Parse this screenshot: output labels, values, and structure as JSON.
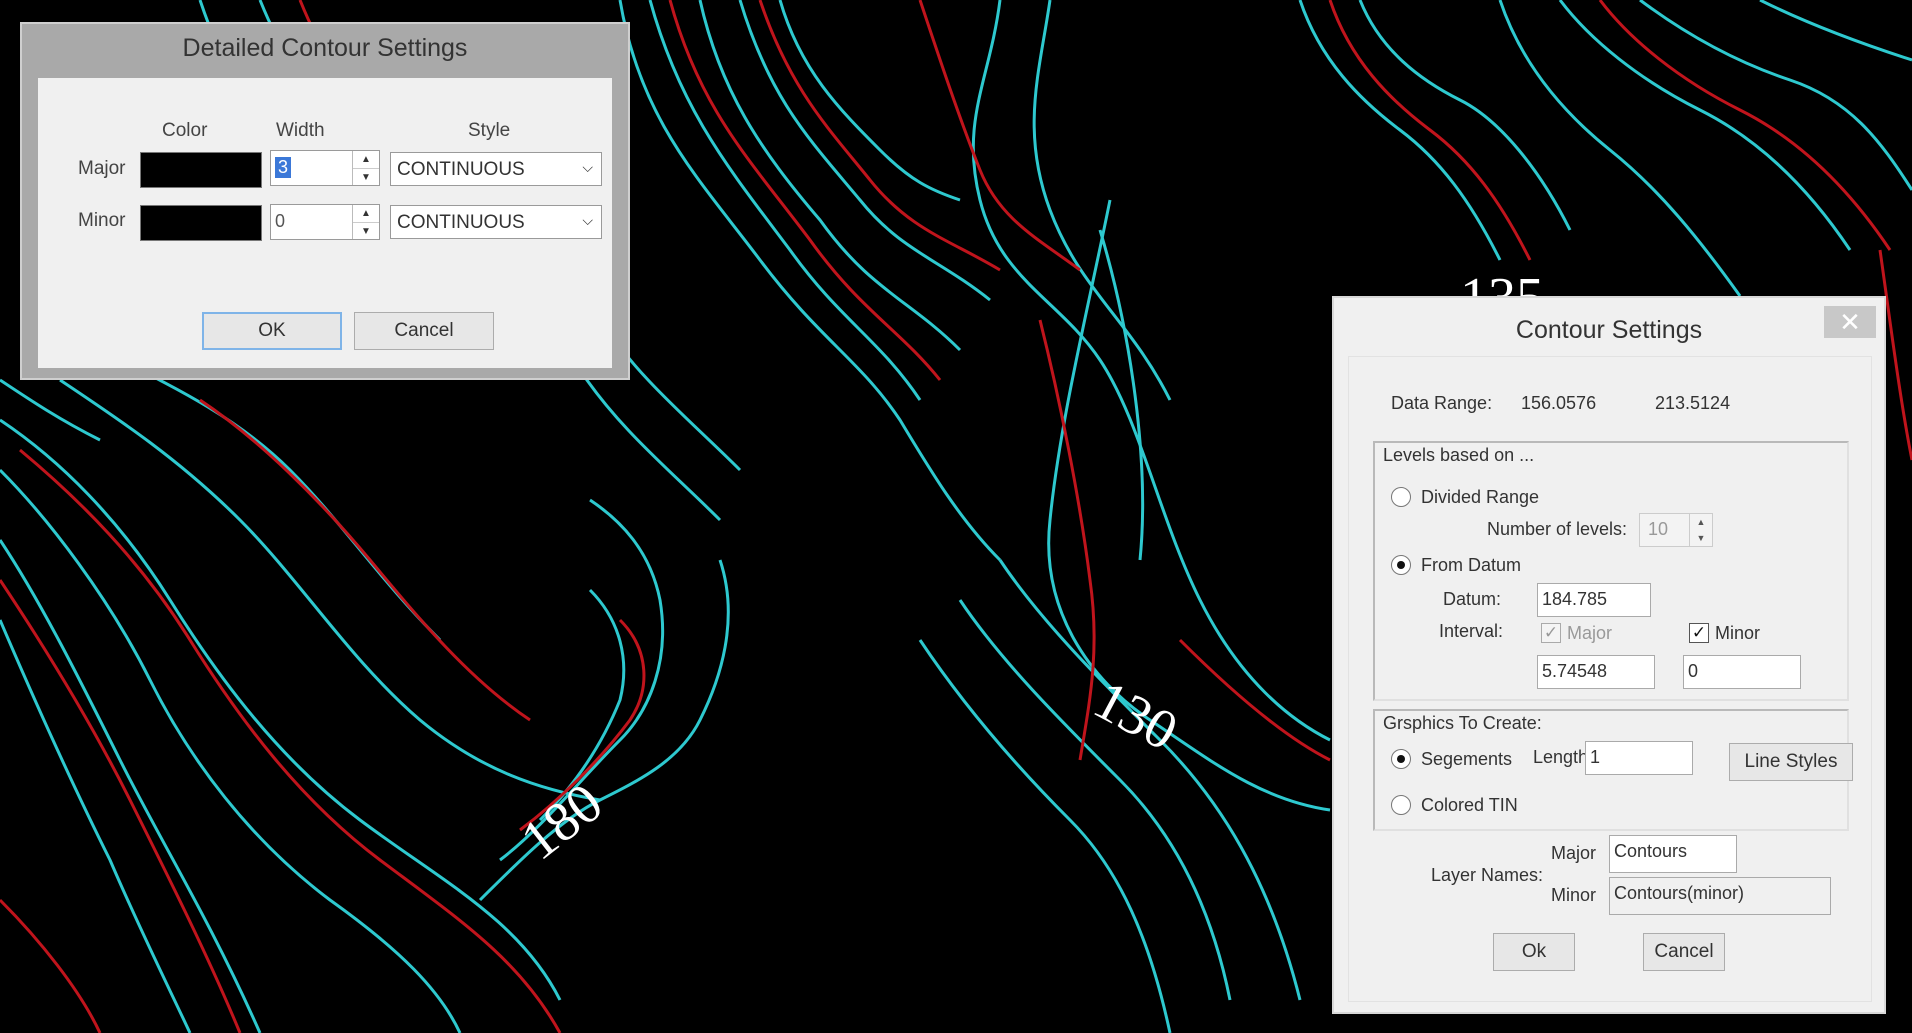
{
  "map": {
    "contour_labels": [
      "180",
      "130",
      "135"
    ],
    "colors": {
      "major_contour": "#c0141c",
      "minor_contour": "#2ec9cf",
      "background": "#000000"
    }
  },
  "detailed_dialog": {
    "title": "Detailed Contour Settings",
    "col_color": "Color",
    "col_width": "Width",
    "col_style": "Style",
    "major": {
      "label": "Major",
      "color": "#000000",
      "width": "3",
      "style": "CONTINUOUS"
    },
    "minor": {
      "label": "Minor",
      "color": "#000000",
      "width": "0",
      "style": "CONTINUOUS"
    },
    "ok": "OK",
    "cancel": "Cancel"
  },
  "contour_dialog": {
    "title": "Contour Settings",
    "close_glyph": "✕",
    "data_range_label": "Data Range:",
    "data_range_min": "156.0576",
    "data_range_max": "213.5124",
    "levels_group": "Levels based on ...",
    "divided_range": "Divided Range",
    "number_of_levels_label": "Number of levels:",
    "number_of_levels": "10",
    "from_datum": "From Datum",
    "datum_label": "Datum:",
    "datum_value": "184.785",
    "interval_label": "Interval:",
    "major_check_label": "Major",
    "minor_check_label": "Minor",
    "major_interval": "5.74548",
    "minor_interval": "0",
    "graphics_group": "Grsphics To Create:",
    "segments": "Segements",
    "length_label": "Length",
    "length_value": "1",
    "line_styles": "Line Styles",
    "colored_tin": "Colored TIN",
    "layer_names_label": "Layer Names:",
    "layer_major_label": "Major",
    "layer_major_value": "Contours",
    "layer_minor_label": "Minor",
    "layer_minor_value": "Contours(minor)",
    "ok": "Ok",
    "cancel": "Cancel"
  }
}
